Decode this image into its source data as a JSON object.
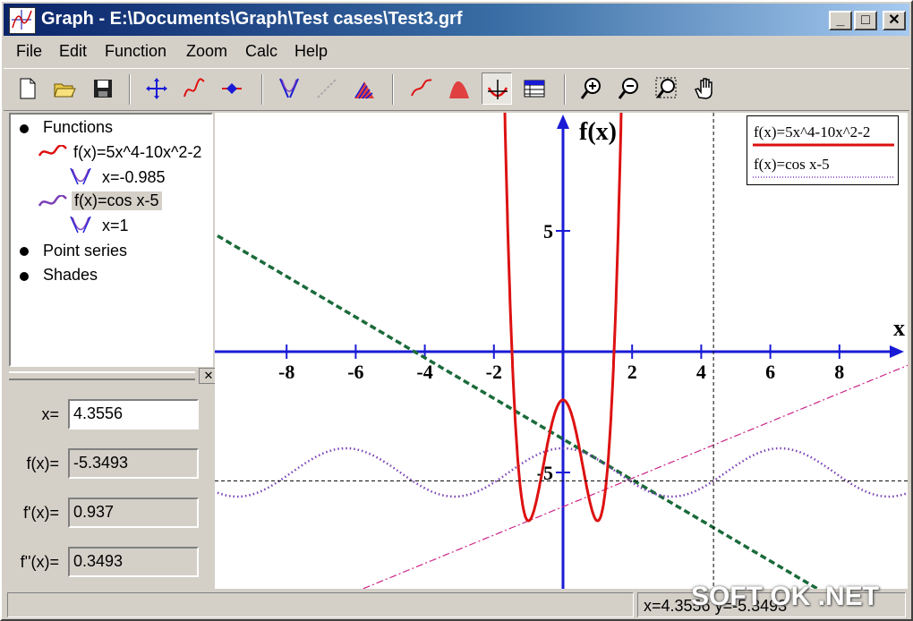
{
  "window": {
    "title": "Graph - E:\\Documents\\Graph\\Test cases\\Test3.grf"
  },
  "menu": [
    "File",
    "Edit",
    "Function",
    "Zoom",
    "Calc",
    "Help"
  ],
  "toolbar": [
    "new-file-icon",
    "open-folder-icon",
    "save-icon",
    "axes-icon",
    "insert-function-icon",
    "insert-point-series-icon",
    "tangent-icon",
    "relation-icon",
    "shade-icon",
    "trendline-icon",
    "area-icon",
    "evaluate-icon",
    "table-icon",
    "zoom-in-icon",
    "zoom-out-icon",
    "zoom-window-icon",
    "pan-hand-icon"
  ],
  "tree": {
    "functions": "Functions",
    "f1": "f(x)=5x^4-10x^2-2",
    "f1_tangent": "x=-0.985",
    "f2": "f(x)=cos x-5",
    "f2_tangent": "x=1",
    "point_series": "Point series",
    "shades": "Shades"
  },
  "evaluate": {
    "x_label": "x=",
    "x_value": "4.3556",
    "fx_label": "f(x)=",
    "fx_value": "-5.3493",
    "dfx_label": "f'(x)=",
    "dfx_value": "0.937",
    "ddfx_label": "f''(x)=",
    "ddfx_value": "0.3493"
  },
  "chart_data": {
    "type": "line",
    "xlabel": "x",
    "ylabel": "f(x)",
    "xlim": [
      -10,
      10
    ],
    "ylim": [
      -9.3,
      9.8
    ],
    "x_ticks": [
      -8,
      -6,
      -4,
      -2,
      2,
      4,
      6,
      8
    ],
    "y_ticks": [
      5,
      -5
    ],
    "series": [
      {
        "name": "f(x)=5x^4-10x^2-2",
        "expr": "5x^4-10x^2-2",
        "color": "#dd1111",
        "style": "solid"
      },
      {
        "name": "f(x)=cos x-5",
        "expr": "cos x-5",
        "color": "#7b3fb5",
        "style": "dotted"
      },
      {
        "expr": "tangent of 5x^4-10x^2-2 at x=-0.985",
        "color": "#cc2288",
        "style": "dash-dot"
      },
      {
        "expr": "tangent of cos x-5 at x=1",
        "color": "#1a6b3a",
        "style": "dashed"
      }
    ],
    "crosshair": {
      "x": 4.3556,
      "y": -5.3493
    },
    "legend": [
      "f(x)=5x^4-10x^2-2",
      "f(x)=cos x-5"
    ]
  },
  "status": {
    "coords": "x=4.3556  y=-5.3493"
  },
  "watermark": "SOFT OK .NET",
  "colors": {
    "axes": "#1a1ad6",
    "title_blue": "#0a246a"
  }
}
